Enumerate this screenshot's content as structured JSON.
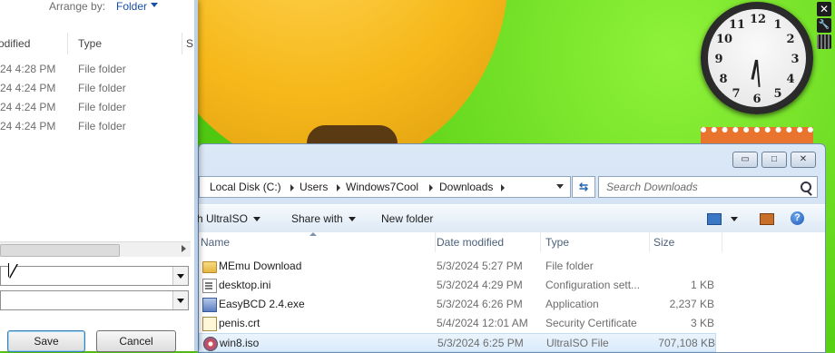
{
  "save_dialog": {
    "arrange_label": "Arrange by:",
    "arrange_value": "Folder",
    "columns": [
      "odified",
      "Type",
      "S"
    ],
    "rows": [
      {
        "date": "24 4:28 PM",
        "type": "File folder"
      },
      {
        "date": "24 4:24 PM",
        "type": "File folder"
      },
      {
        "date": "24 4:24 PM",
        "type": "File folder"
      },
      {
        "date": "24 4:24 PM",
        "type": "File folder"
      }
    ],
    "save_label": "Save",
    "cancel_label": "Cancel"
  },
  "gadgets": {
    "clock_numbers": [
      "12",
      "1",
      "2",
      "3",
      "4",
      "5",
      "6",
      "7",
      "8",
      "9",
      "10",
      "11"
    ],
    "close_glyph": "✕",
    "settings_glyph": "🔧"
  },
  "explorer": {
    "window_buttons": {
      "minimize": "▭",
      "maximize": "□",
      "close": "✕"
    },
    "breadcrumb": [
      "Local Disk (C:)",
      "Users",
      "Windows7Cool",
      "Downloads"
    ],
    "refresh_glyph": "⇆",
    "search_placeholder": "Search Downloads",
    "toolbar": {
      "burn": "h UltraISO",
      "share": "Share with",
      "new_folder": "New folder",
      "help": "?"
    },
    "columns": {
      "name": "Name",
      "date": "Date modified",
      "type": "Type",
      "size": "Size"
    },
    "files": [
      {
        "name": "MEmu Download",
        "date": "5/3/2024 5:27 PM",
        "type": "File folder",
        "size": "",
        "icon": "folder-icon"
      },
      {
        "name": "desktop.ini",
        "date": "5/3/2024 4:29 PM",
        "type": "Configuration sett...",
        "size": "1 KB",
        "icon": "ini-file-icon"
      },
      {
        "name": "EasyBCD 2.4.exe",
        "date": "5/3/2024 6:26 PM",
        "type": "Application",
        "size": "2,237 KB",
        "icon": "exe-file-icon"
      },
      {
        "name": "penis.crt",
        "date": "5/4/2024 12:01 AM",
        "type": "Security Certificate",
        "size": "3 KB",
        "icon": "certificate-file-icon"
      },
      {
        "name": "win8.iso",
        "date": "5/3/2024 6:25 PM",
        "type": "UltraISO File",
        "size": "707,108 KB",
        "icon": "iso-file-icon"
      }
    ],
    "selected_file": "win8.iso"
  }
}
